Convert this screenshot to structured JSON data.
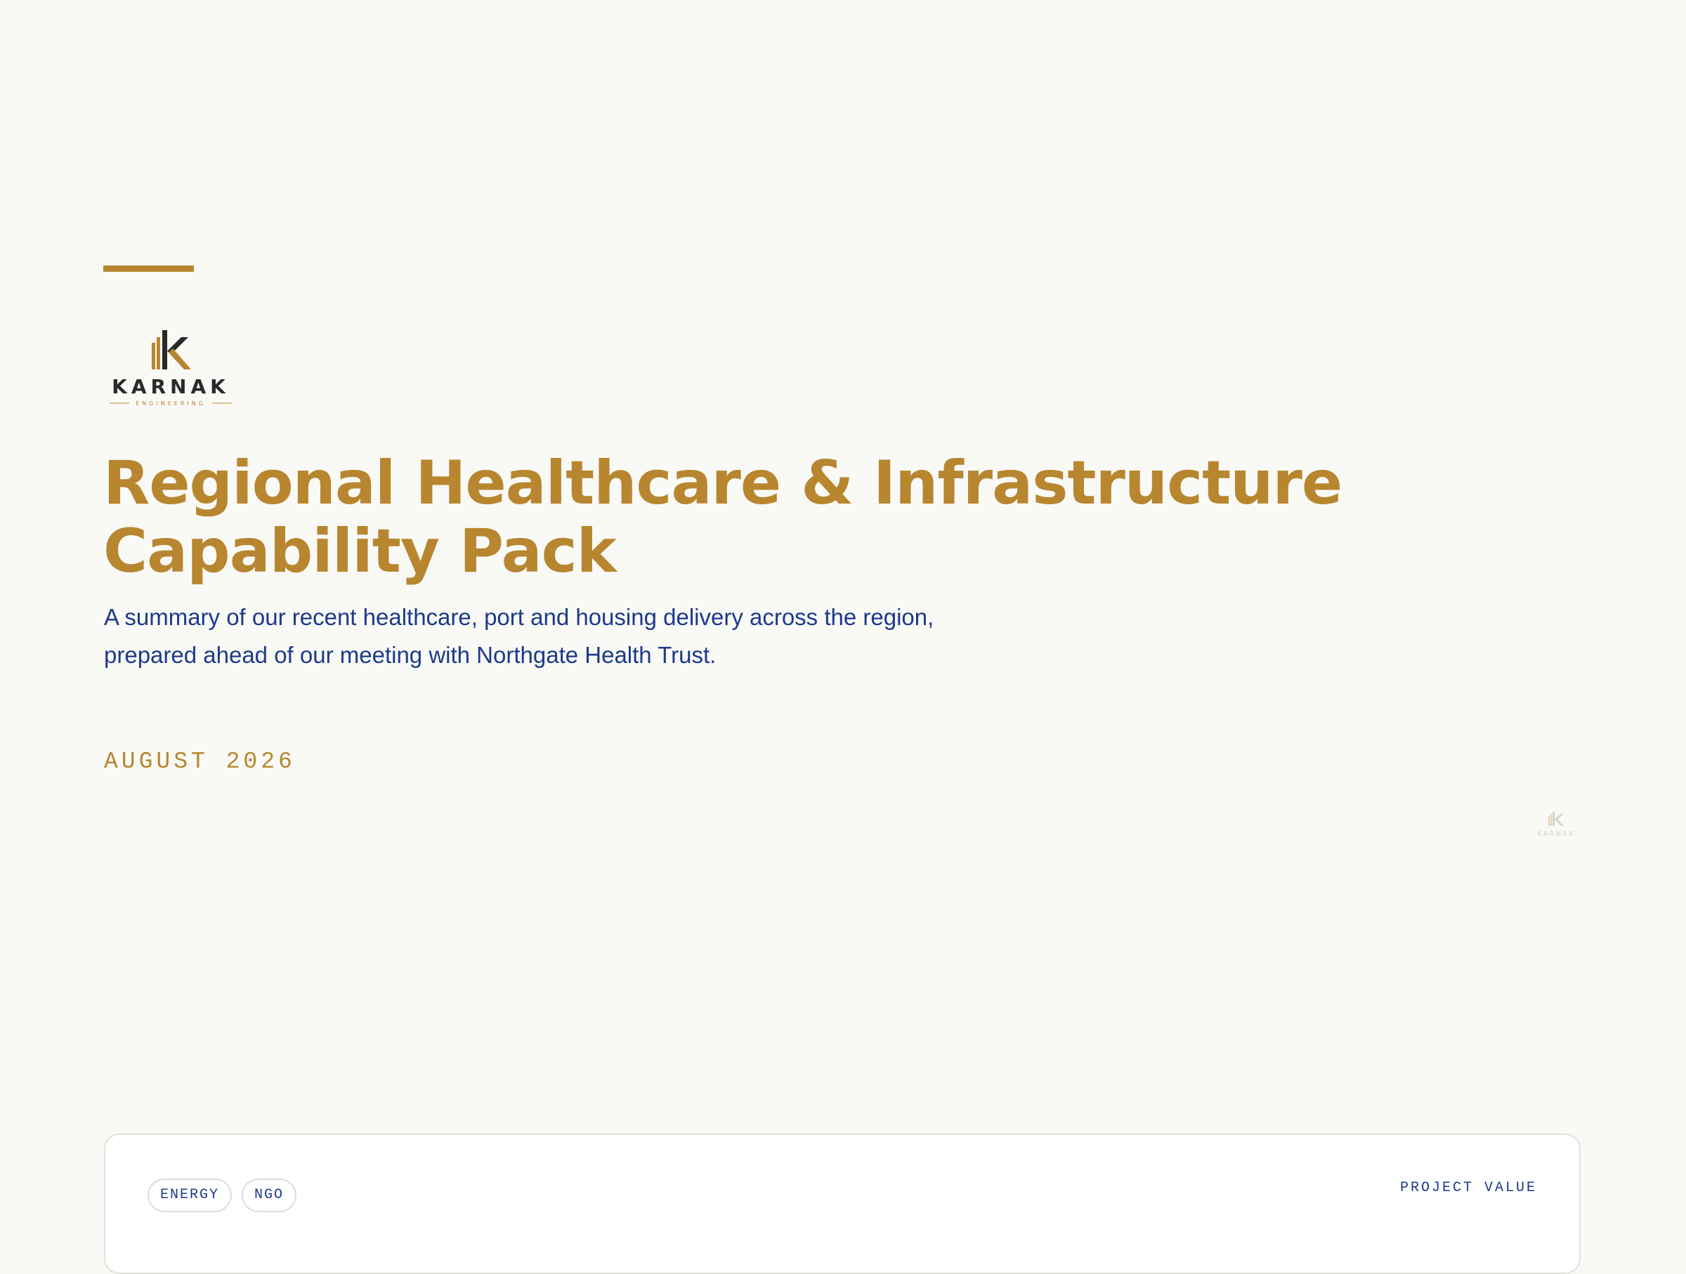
{
  "brand": {
    "name": "KARNAK",
    "tagline": "ENGINEERING",
    "accent_color": "#b7862f",
    "dark_color": "#2a2a2a",
    "text_color": "#1d3a8a"
  },
  "cover": {
    "title": "Regional Healthcare & Infrastructure Capability Pack",
    "subtitle": "A summary of our recent healthcare, port and housing delivery across the region, prepared ahead of our meeting with Northgate Health Trust.",
    "date": "AUGUST 2026"
  },
  "project_card": {
    "tags": [
      "ENERGY",
      "NGO"
    ],
    "value_label": "PROJECT VALUE"
  }
}
